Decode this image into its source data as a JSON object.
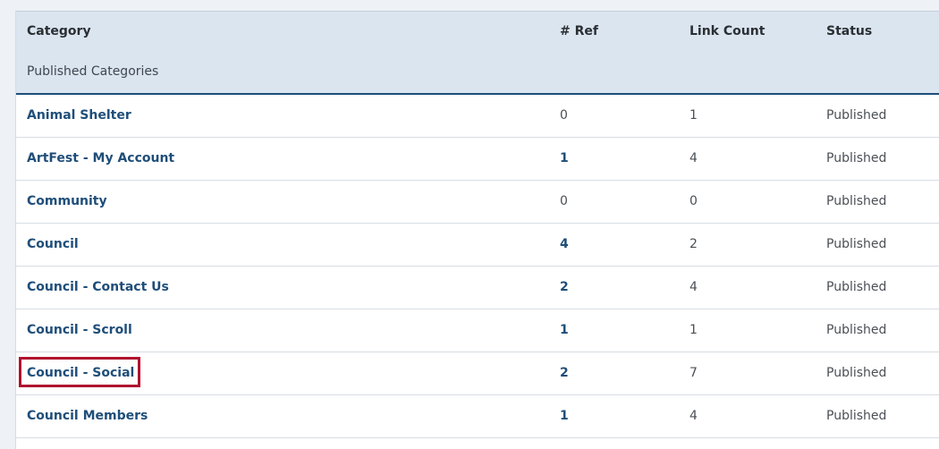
{
  "table": {
    "headers": {
      "category": "Category",
      "ref": "# Ref",
      "link_count": "Link Count",
      "status": "Status"
    },
    "group_label": "Published Categories",
    "rows": [
      {
        "category": "Animal Shelter",
        "ref": "0",
        "link_count": "1",
        "status": "Published"
      },
      {
        "category": "ArtFest - My Account",
        "ref": "1",
        "link_count": "4",
        "status": "Published"
      },
      {
        "category": "Community",
        "ref": "0",
        "link_count": "0",
        "status": "Published"
      },
      {
        "category": "Council",
        "ref": "4",
        "link_count": "2",
        "status": "Published"
      },
      {
        "category": "Council - Contact Us",
        "ref": "2",
        "link_count": "4",
        "status": "Published"
      },
      {
        "category": "Council - Scroll",
        "ref": "1",
        "link_count": "1",
        "status": "Published"
      },
      {
        "category": "Council - Social",
        "ref": "2",
        "link_count": "7",
        "status": "Published",
        "highlighted": true
      },
      {
        "category": "Council Members",
        "ref": "1",
        "link_count": "4",
        "status": "Published"
      }
    ]
  },
  "colors": {
    "link": "#1f4e79",
    "header_bg": "#dbe5f0",
    "highlight_border": "#b0122f"
  }
}
